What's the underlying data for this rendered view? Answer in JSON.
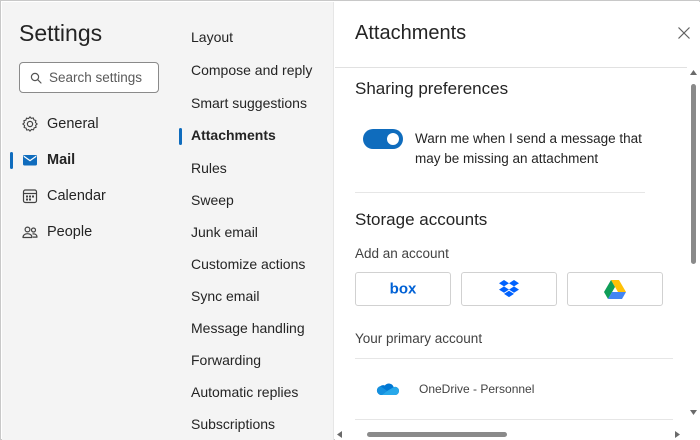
{
  "nav": {
    "title": "Settings",
    "search_placeholder": "Search settings",
    "items": [
      {
        "label": "General",
        "icon": "gear-icon"
      },
      {
        "label": "Mail",
        "icon": "mail-icon",
        "active": true
      },
      {
        "label": "Calendar",
        "icon": "calendar-icon"
      },
      {
        "label": "People",
        "icon": "people-icon"
      }
    ]
  },
  "subnav": {
    "items": [
      {
        "label": "Layout"
      },
      {
        "label": "Compose and reply"
      },
      {
        "label": "Smart suggestions"
      },
      {
        "label": "Attachments",
        "active": true
      },
      {
        "label": "Rules"
      },
      {
        "label": "Sweep"
      },
      {
        "label": "Junk email"
      },
      {
        "label": "Customize actions"
      },
      {
        "label": "Sync email"
      },
      {
        "label": "Message handling"
      },
      {
        "label": "Forwarding"
      },
      {
        "label": "Automatic replies"
      },
      {
        "label": "Subscriptions"
      }
    ]
  },
  "content": {
    "title": "Attachments",
    "sharing": {
      "title": "Sharing preferences",
      "toggle_label": "Warn me when I send a message that may be missing an attachment",
      "toggle_on": true
    },
    "storage": {
      "title": "Storage accounts",
      "add_label": "Add an account",
      "providers": [
        {
          "name": "box",
          "icon": "box-logo"
        },
        {
          "name": "dropbox",
          "icon": "dropbox-icon"
        },
        {
          "name": "google-drive",
          "icon": "google-drive-icon"
        }
      ],
      "primary_label": "Your primary account",
      "primary_account": {
        "name": "OneDrive - Personnel",
        "icon": "onedrive-icon"
      }
    }
  },
  "colors": {
    "accent": "#0f6cbd",
    "nav_bg": "#f4f4f4",
    "box_blue": "#0061d5",
    "dropbox_blue": "#0061fe",
    "onedrive_blue": "#0364b8"
  }
}
